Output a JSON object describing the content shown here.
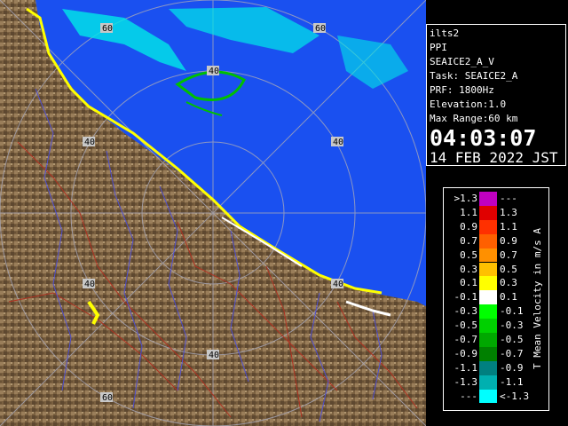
{
  "info": {
    "station": "ilts2",
    "product": "PPI",
    "scan": "SEAICE2_A_V",
    "task": "Task: SEAICE2_A",
    "prf": "PRF: 1800Hz",
    "elevation": "Elevation:1.0",
    "range": "Max Range:60 km",
    "time": "04:03:07",
    "date": "14 FEB 2022 JST"
  },
  "legend": {
    "unit_label": "Mean Velocity in m/s",
    "top_marker": "A",
    "bottom_marker": "T",
    "rows": [
      {
        "low": ">1.3",
        "high": "---",
        "color": "#c000c0"
      },
      {
        "low": "1.1",
        "high": "1.3",
        "color": "#e00000"
      },
      {
        "low": "0.9",
        "high": "1.1",
        "color": "#ff3000"
      },
      {
        "low": "0.7",
        "high": "0.9",
        "color": "#ff6000"
      },
      {
        "low": "0.5",
        "high": "0.7",
        "color": "#ff9000"
      },
      {
        "low": "0.3",
        "high": "0.5",
        "color": "#ffc000"
      },
      {
        "low": "0.1",
        "high": "0.3",
        "color": "#ffff00"
      },
      {
        "low": "-0.1",
        "high": "0.1",
        "color": "#ffffff"
      },
      {
        "low": "-0.3",
        "high": "-0.1",
        "color": "#00ff00"
      },
      {
        "low": "-0.5",
        "high": "-0.3",
        "color": "#00d000"
      },
      {
        "low": "-0.7",
        "high": "-0.5",
        "color": "#00a800"
      },
      {
        "low": "-0.9",
        "high": "-0.7",
        "color": "#008000"
      },
      {
        "low": "-1.1",
        "high": "-0.9",
        "color": "#008080"
      },
      {
        "low": "-1.3",
        "high": "-1.1",
        "color": "#00b0b0"
      },
      {
        "low": "---",
        "high": "<-1.3",
        "color": "#00ffff"
      }
    ]
  },
  "map": {
    "range_labels": [
      "60",
      "40",
      "40",
      "40",
      "40",
      "40",
      "60"
    ],
    "colors": {
      "sea": "#1a50f0",
      "land": "#7a6040",
      "rings": "#9aa0b0",
      "roads": "#b03020",
      "rivers": "#5050d0"
    }
  }
}
